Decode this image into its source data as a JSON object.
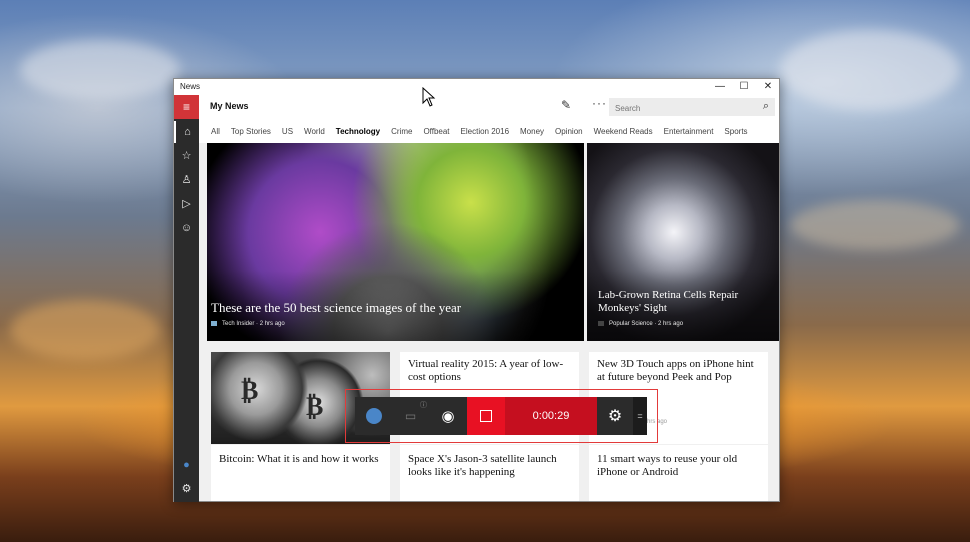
{
  "window": {
    "title": "News",
    "controls": {
      "minimize": "—",
      "maximize": "☐",
      "close": "✕"
    }
  },
  "nav": {
    "menu": "≡",
    "items": [
      {
        "name": "home",
        "glyph": "⌂"
      },
      {
        "name": "favorites",
        "glyph": "☆"
      },
      {
        "name": "local",
        "glyph": "♙"
      },
      {
        "name": "video",
        "glyph": "▷"
      },
      {
        "name": "feedback",
        "glyph": "☺"
      }
    ],
    "bottom": [
      {
        "name": "account",
        "glyph": "●"
      },
      {
        "name": "settings",
        "glyph": "⚙"
      }
    ]
  },
  "header": {
    "title": "My News",
    "pen": "✎",
    "more": "···",
    "search_placeholder": "Search",
    "search_glyph": "⌕"
  },
  "tabs": [
    {
      "label": "All",
      "active": false
    },
    {
      "label": "Top Stories",
      "active": false
    },
    {
      "label": "US",
      "active": false
    },
    {
      "label": "World",
      "active": false
    },
    {
      "label": "Technology",
      "active": true
    },
    {
      "label": "Crime",
      "active": false
    },
    {
      "label": "Offbeat",
      "active": false
    },
    {
      "label": "Election 2016",
      "active": false
    },
    {
      "label": "Money",
      "active": false
    },
    {
      "label": "Opinion",
      "active": false
    },
    {
      "label": "Weekend Reads",
      "active": false
    },
    {
      "label": "Entertainment",
      "active": false
    },
    {
      "label": "Sports",
      "active": false
    }
  ],
  "hero": {
    "title": "These are the 50 best science images of the year",
    "source": "Tech Insider",
    "time": "2 hrs ago"
  },
  "second": {
    "title": "Lab-Grown Retina Cells Repair Monkeys' Sight",
    "source": "Popular Science",
    "time": "2 hrs ago"
  },
  "cards": {
    "vr": "Virtual reality 2015: A year of low-cost options",
    "touch": "New 3D Touch apps on iPhone hint at future beyond Peek and Pop",
    "touch_time": "hrs ago",
    "bitcoin": "Bitcoin: What it is and how it works",
    "spacex": "Space X's Jason-3 satellite launch looks like it's happening",
    "smart": "11 smart ways to reuse your old iPhone or Android"
  },
  "gamebar": {
    "timer": "0:00:29",
    "info_glyph": "ⓘ",
    "camera_glyph": "◉",
    "settings_glyph": "⚙",
    "handle_glyph": "="
  },
  "colors": {
    "accent": "#d13438",
    "record": "#e81123",
    "timer_bg": "#c50f1f"
  }
}
